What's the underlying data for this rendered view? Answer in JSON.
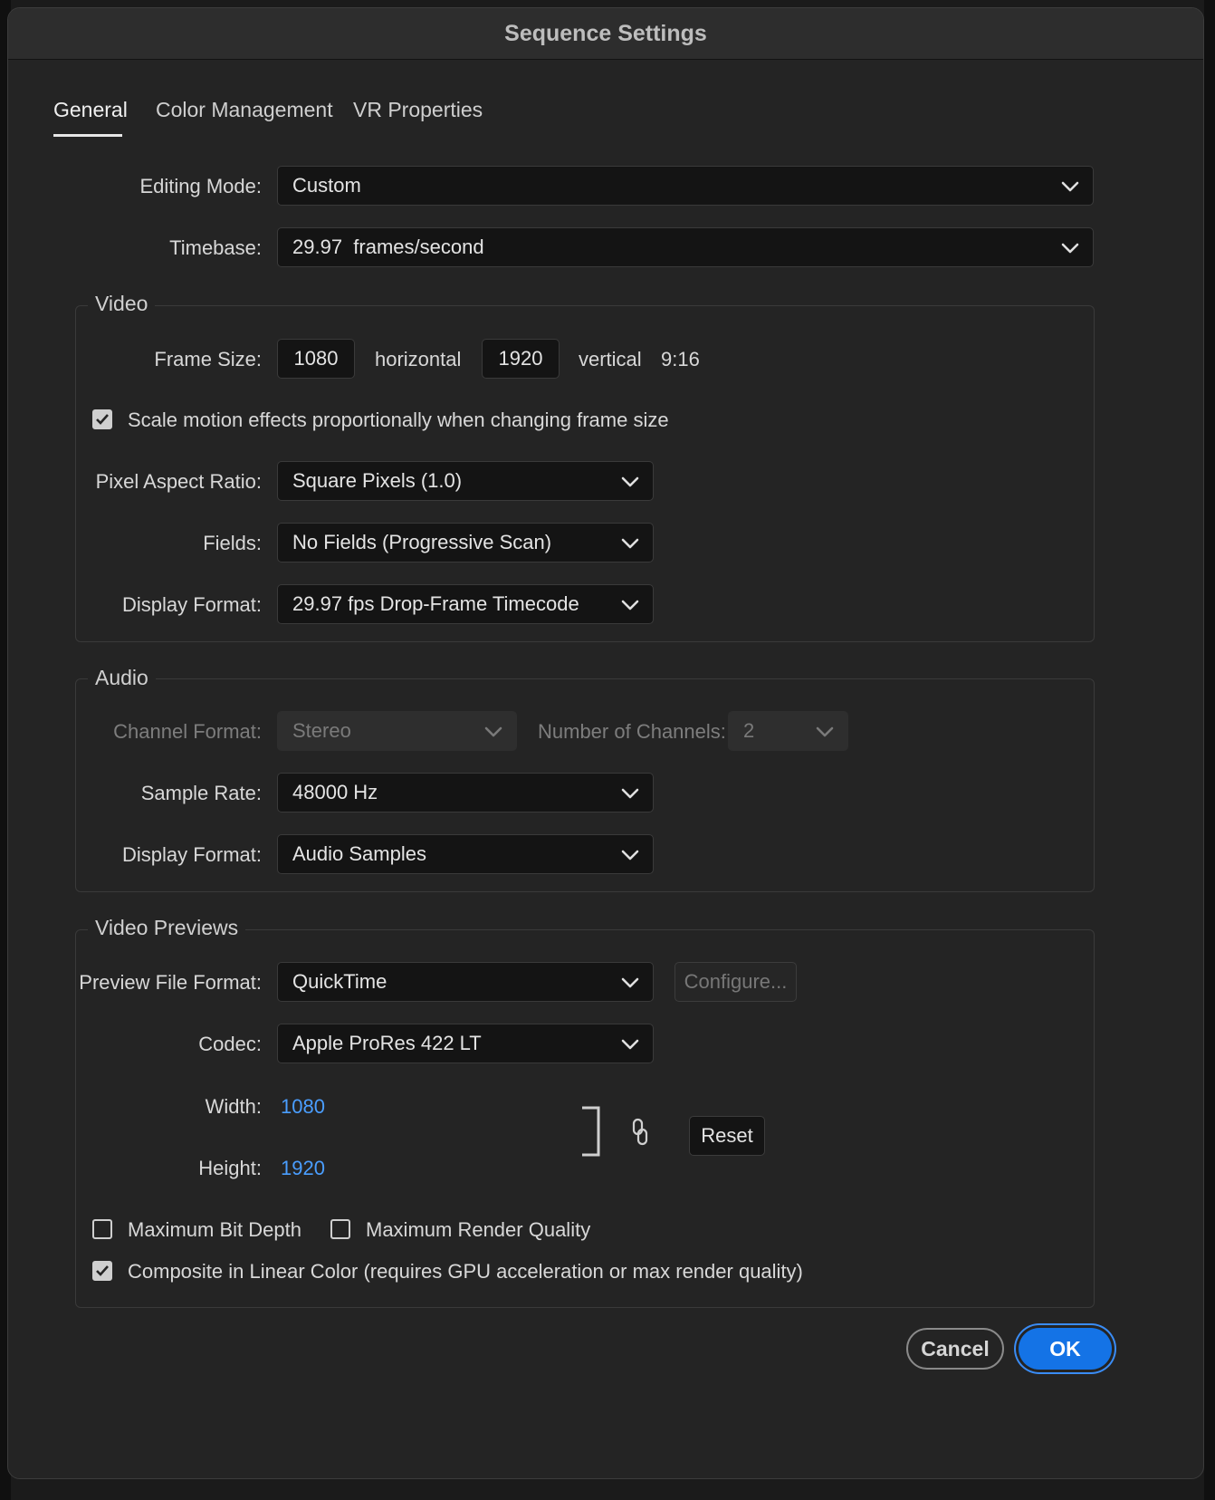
{
  "dialog": {
    "title": "Sequence Settings"
  },
  "tabs": [
    {
      "label": "General",
      "active": true
    },
    {
      "label": "Color Management",
      "active": false
    },
    {
      "label": "VR Properties",
      "active": false
    }
  ],
  "general": {
    "editing_mode_label": "Editing Mode:",
    "editing_mode_value": "Custom",
    "timebase_label": "Timebase:",
    "timebase_value": "29.97  frames/second"
  },
  "video": {
    "legend": "Video",
    "frame_size_label": "Frame Size:",
    "frame_width": "1080",
    "horizontal_label": "horizontal",
    "frame_height": "1920",
    "vertical_label": "vertical",
    "aspect": "9:16",
    "scale_motion_label": "Scale motion effects proportionally when changing frame size",
    "scale_motion_checked": true,
    "par_label": "Pixel Aspect Ratio:",
    "par_value": "Square Pixels (1.0)",
    "fields_label": "Fields:",
    "fields_value": "No Fields (Progressive Scan)",
    "display_format_label": "Display Format:",
    "display_format_value": "29.97 fps Drop-Frame Timecode"
  },
  "audio": {
    "legend": "Audio",
    "channel_format_label": "Channel Format:",
    "channel_format_value": "Stereo",
    "num_channels_label": "Number of Channels:",
    "num_channels_value": "2",
    "sample_rate_label": "Sample Rate:",
    "sample_rate_value": "48000 Hz",
    "display_format_label": "Display Format:",
    "display_format_value": "Audio Samples"
  },
  "previews": {
    "legend": "Video Previews",
    "file_format_label": "Preview File Format:",
    "file_format_value": "QuickTime",
    "configure_label": "Configure...",
    "codec_label": "Codec:",
    "codec_value": "Apple ProRes 422 LT",
    "width_label": "Width:",
    "width_value": "1080",
    "height_label": "Height:",
    "height_value": "1920",
    "reset_label": "Reset",
    "max_bit_depth_label": "Maximum Bit Depth",
    "max_bit_depth_checked": false,
    "max_render_quality_label": "Maximum Render Quality",
    "max_render_quality_checked": false,
    "linear_color_label": "Composite in Linear Color (requires GPU acceleration or max render quality)",
    "linear_color_checked": true
  },
  "footer": {
    "cancel_label": "Cancel",
    "ok_label": "OK"
  },
  "colors": {
    "accent": "#1473e6",
    "link_value": "#4a9eff",
    "background": "#242424"
  },
  "icons": [
    "chevron-down-icon",
    "checkmark-icon",
    "chain-link-icon",
    "bracket-icon"
  ]
}
